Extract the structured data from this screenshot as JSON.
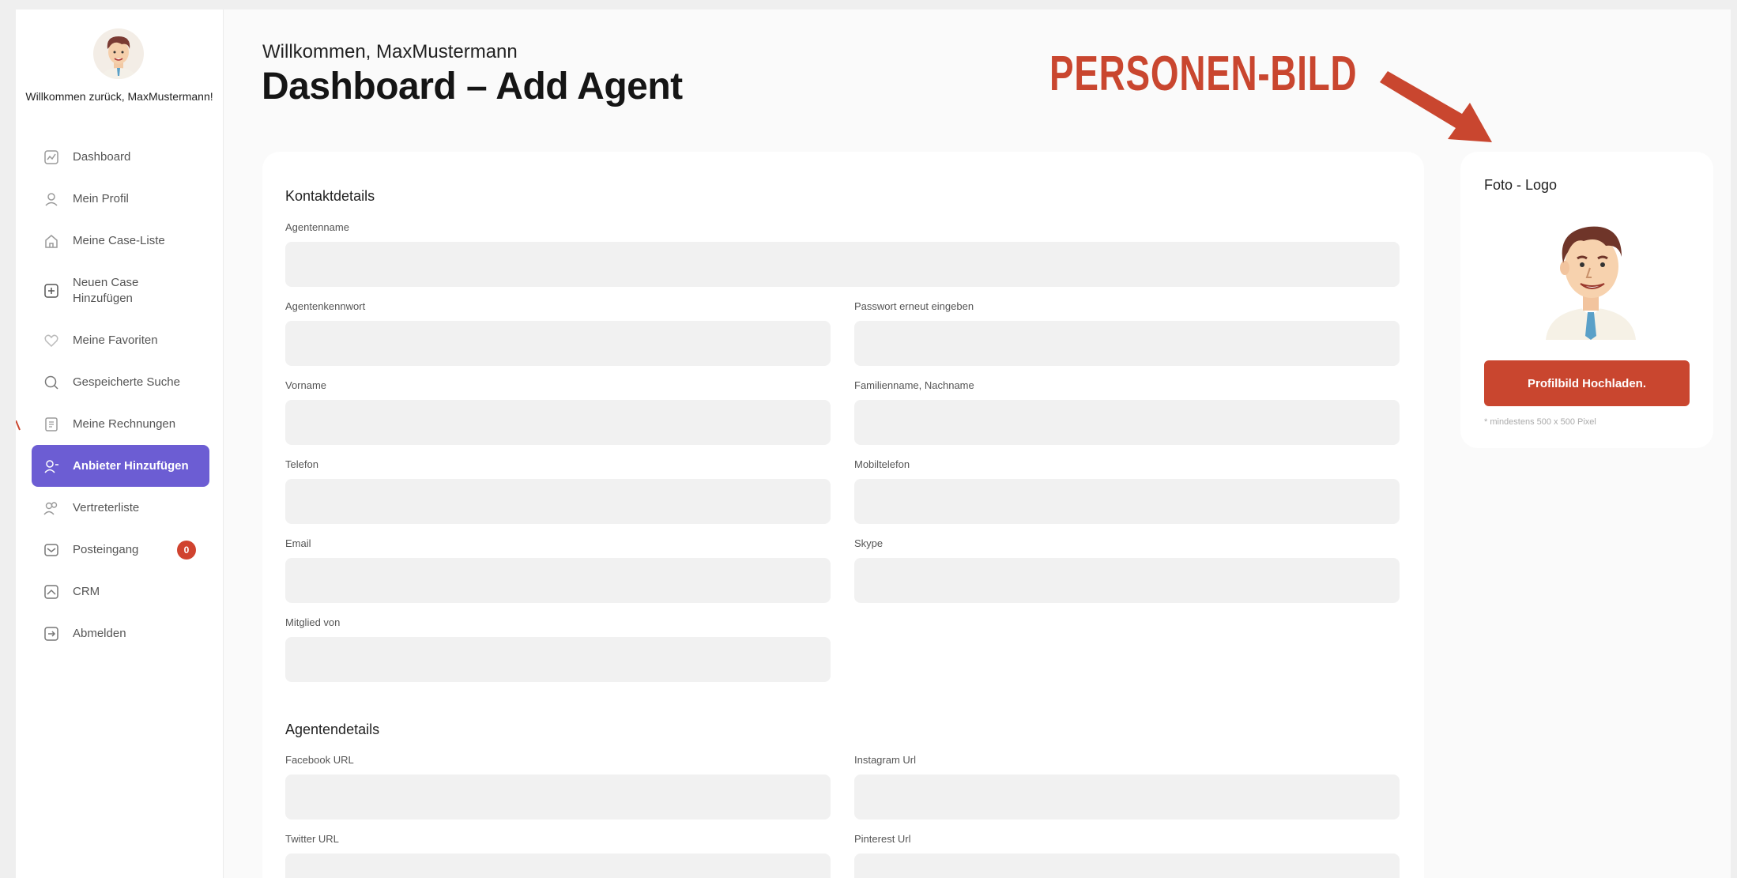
{
  "sidebar": {
    "welcome": "Willkommen zurück, MaxMustermann!",
    "items": [
      {
        "label": "Dashboard"
      },
      {
        "label": "Mein Profil"
      },
      {
        "label": "Meine Case-Liste"
      },
      {
        "label": "Neuen Case Hinzufügen"
      },
      {
        "label": "Meine Favoriten"
      },
      {
        "label": "Gespeicherte Suche"
      },
      {
        "label": "Meine Rechnungen"
      },
      {
        "label": "Anbieter Hinzufügen"
      },
      {
        "label": "Vertreterliste"
      },
      {
        "label": "Posteingang",
        "badge": "0"
      },
      {
        "label": "CRM"
      },
      {
        "label": "Abmelden"
      }
    ]
  },
  "header": {
    "greeting": "Willkommen, MaxMustermann",
    "title": "Dashboard – Add Agent"
  },
  "annotation": {
    "text": "PERSONEN-BILD",
    "color": "#c9462f"
  },
  "form": {
    "contact_title": "Kontaktdetails",
    "agent_details_title": "Agentendetails",
    "fields": {
      "agent_name": {
        "label": "Agentenname",
        "value": ""
      },
      "agent_password": {
        "label": "Agentenkennwort",
        "value": ""
      },
      "password_repeat": {
        "label": "Passwort erneut eingeben",
        "value": ""
      },
      "first_name": {
        "label": "Vorname",
        "value": ""
      },
      "last_name": {
        "label": "Familienname, Nachname",
        "value": ""
      },
      "phone": {
        "label": "Telefon",
        "value": ""
      },
      "mobile": {
        "label": "Mobiltelefon",
        "value": ""
      },
      "email": {
        "label": "Email",
        "value": ""
      },
      "skype": {
        "label": "Skype",
        "value": ""
      },
      "member_of": {
        "label": "Mitglied von",
        "value": ""
      },
      "facebook": {
        "label": "Facebook URL",
        "value": ""
      },
      "instagram": {
        "label": "Instagram Url",
        "value": ""
      },
      "twitter": {
        "label": "Twitter URL",
        "value": ""
      },
      "pinterest": {
        "label": "Pinterest Url",
        "value": ""
      }
    }
  },
  "photo": {
    "title": "Foto - Logo",
    "upload_label": "Profilbild Hochladen.",
    "hint": "* mindestens 500 x 500 Pixel"
  },
  "colors": {
    "accent": "#6c5dd3",
    "brand_red": "#c9462f",
    "input_bg": "#f1f1f1"
  },
  "icons": [
    "chart-icon",
    "user-icon",
    "home-icon",
    "plus-square-icon",
    "heart-icon",
    "search-icon",
    "invoice-icon",
    "add-user-icon",
    "users-icon",
    "inbox-icon",
    "crm-icon",
    "logout-icon"
  ]
}
